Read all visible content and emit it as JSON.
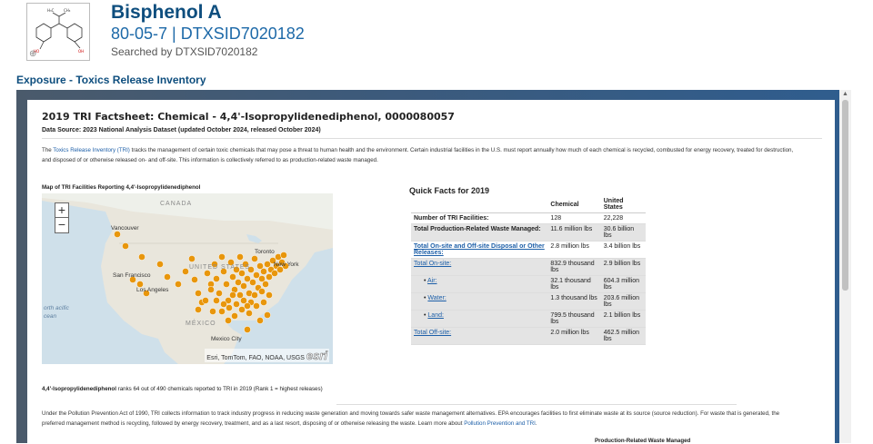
{
  "header": {
    "name": "Bisphenol A",
    "ids": "80-05-7 | DTXSID7020182",
    "searched_by": "Searched by DTXSID7020182",
    "structure_labels": {
      "ch3_a": "H₃C",
      "ch3_b": "CH₃",
      "oh_left": "HO",
      "oh_right": "OH"
    }
  },
  "section_title": "Exposure - Toxics Release Inventory",
  "factsheet": {
    "title": "2019 TRI Factsheet: Chemical - 4,4'-Isopropylidenediphenol, 0000080057",
    "data_source": "Data Source: 2023 National Analysis Dataset (updated October 2024, released October 2024)",
    "intro_before": "The ",
    "intro_link": "Toxics Release Inventory (TRI)",
    "intro_after": " tracks the management of certain toxic chemicals that may pose a threat to human health and the environment. Certain industrial facilities in the U.S. must report annually how much of each chemical is recycled, combusted for energy recovery, treated for destruction, and disposed of or otherwise released on- and off-site. This information is collectively referred to as production-related waste managed."
  },
  "map": {
    "title": "Map of TRI Facilities Reporting 4,4'-Isopropylidenediphenol",
    "zoom_in": "+",
    "zoom_out": "−",
    "labels": {
      "canada": "CANADA",
      "vancouver": "Vancouver",
      "toronto": "Toronto",
      "new_york": "New York",
      "united_states": "UNITED STATES",
      "san_francisco": "San Francisco",
      "los_angeles": "Los Angeles",
      "mexico": "MÉXICO",
      "mexico_city": "Mexico City",
      "ocean": "orth acific cean"
    },
    "attribution": "Esri, TomTom, FAO, NOAA, USGS",
    "esri_logo": "esri",
    "dot_color": "#e8960c",
    "facility_count": 128
  },
  "quick_facts": {
    "title": "Quick Facts for 2019",
    "col_chemical": "Chemical",
    "col_us": "United States",
    "rows": [
      {
        "label": "Number of TRI Facilities:",
        "chem": "128",
        "us": "22,228"
      },
      {
        "label": "Total Production-Related Waste Managed:",
        "chem": "11.6 million lbs",
        "us": "30.6 billion lbs"
      },
      {
        "label": "Total On-site and Off-site Disposal or Other Releases:",
        "chem": "2.8 million lbs",
        "us": "3.4 billion lbs"
      },
      {
        "label": "Total On-site:",
        "chem": "832.9 thousand lbs",
        "us": "2.9 billion lbs"
      },
      {
        "label": "Air:",
        "chem": "32.1 thousand lbs",
        "us": "604.3 million lbs"
      },
      {
        "label": "Water:",
        "chem": "1.3 thousand lbs",
        "us": "203.6 million lbs"
      },
      {
        "label": "Land:",
        "chem": "799.5 thousand lbs",
        "us": "2.1 billion lbs"
      },
      {
        "label": "Total Off-site:",
        "chem": "2.0 million lbs",
        "us": "462.5 million lbs"
      }
    ]
  },
  "rank": {
    "chem": "4,4'-Isopropylidenediphenol",
    "text": " ranks 64 out of 490 chemicals reported to TRI in 2019 (Rank 1 = highest releases)"
  },
  "ppa": {
    "text": "Under the Pollution Prevention Act of 1990, TRI collects information to track industry progress in reducing waste generation and moving towards safer waste management alternatives. EPA encourages facilities to first eliminate waste at its source (source reduction). For waste that is generated, the preferred management method is recycling, followed by energy recovery, treatment, and as a last resort, disposing of or otherwise releasing the waste. Learn more about ",
    "link": "Pollution Prevention and TRI",
    "after": "."
  },
  "cut_heading": "Production-Related Waste Managed"
}
